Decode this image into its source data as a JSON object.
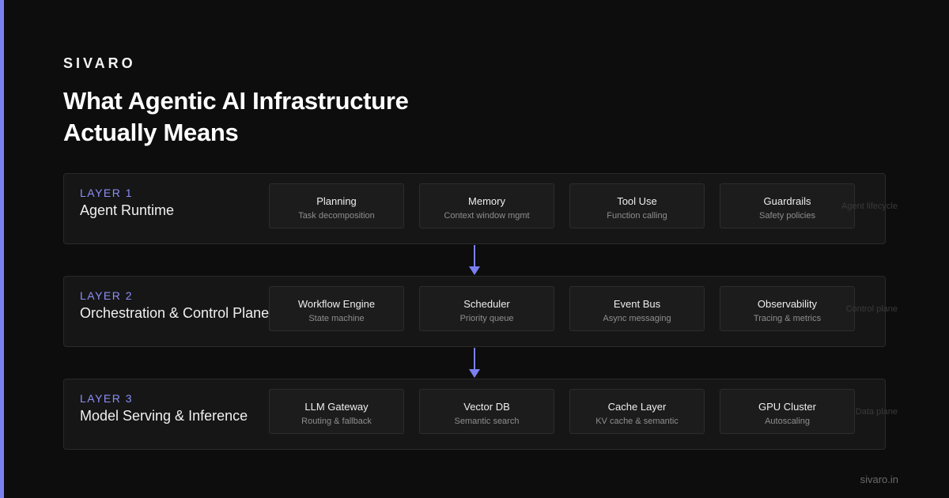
{
  "brand": "SIVARO",
  "headline": "What Agentic AI Infrastructure Actually Means",
  "layers": [
    {
      "number": "LAYER 1",
      "name": "Agent Runtime",
      "tag": "Agent lifecycle",
      "components": [
        {
          "title": "Planning",
          "subtitle": "Task decomposition"
        },
        {
          "title": "Memory",
          "subtitle": "Context window mgmt"
        },
        {
          "title": "Tool Use",
          "subtitle": "Function calling"
        },
        {
          "title": "Guardrails",
          "subtitle": "Safety policies"
        }
      ]
    },
    {
      "number": "LAYER 2",
      "name": "Orchestration & Control Plane",
      "tag": "Control plane",
      "components": [
        {
          "title": "Workflow Engine",
          "subtitle": "State machine"
        },
        {
          "title": "Scheduler",
          "subtitle": "Priority queue"
        },
        {
          "title": "Event Bus",
          "subtitle": "Async messaging"
        },
        {
          "title": "Observability",
          "subtitle": "Tracing & metrics"
        }
      ]
    },
    {
      "number": "LAYER 3",
      "name": "Model Serving & Inference",
      "tag": "Data plane",
      "components": [
        {
          "title": "LLM Gateway",
          "subtitle": "Routing & fallback"
        },
        {
          "title": "Vector DB",
          "subtitle": "Semantic search"
        },
        {
          "title": "Cache Layer",
          "subtitle": "KV cache & semantic"
        },
        {
          "title": "GPU Cluster",
          "subtitle": "Autoscaling"
        }
      ]
    }
  ],
  "footer": "sivaro.in",
  "colors": {
    "accent": "#7b80f0",
    "background": "#0d0d0d",
    "panel": "#161616"
  }
}
